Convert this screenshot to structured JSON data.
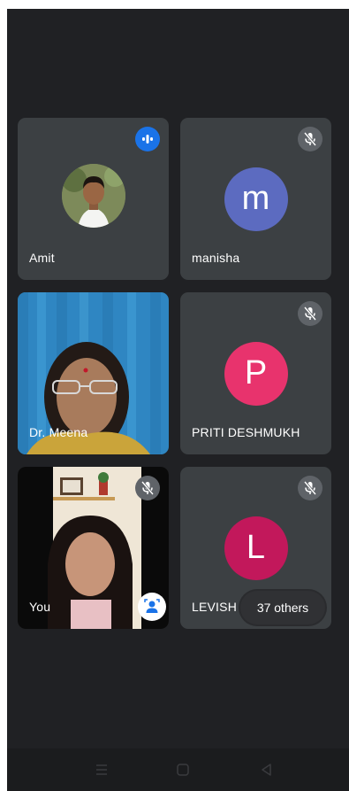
{
  "participants": [
    {
      "name": "Amit",
      "status": "speaking",
      "avatar": "photo"
    },
    {
      "name": "manisha",
      "status": "muted",
      "avatar_letter": "m",
      "avatar_color": "#5c6bc0"
    },
    {
      "name": "Dr. Meena",
      "status": "video",
      "avatar": "video"
    },
    {
      "name": "PRITI DESHMUKH",
      "status": "muted",
      "avatar_letter": "P",
      "avatar_color": "#e8336d"
    },
    {
      "name": "You",
      "status": "muted",
      "avatar": "video"
    },
    {
      "name": "LEVISH K",
      "status": "muted",
      "avatar_letter": "L",
      "avatar_color": "#c2185b"
    }
  ],
  "others_label": "37 others",
  "icons": {
    "speaking": "speaking-indicator-icon",
    "muted": "mic-off-icon",
    "effects": "visual-effects-icon",
    "nav_menu": "menu-icon",
    "nav_home": "home-icon",
    "nav_back": "back-icon"
  },
  "colors": {
    "background": "#202124",
    "tile": "#3c4043",
    "speaking": "#1a73e8"
  }
}
